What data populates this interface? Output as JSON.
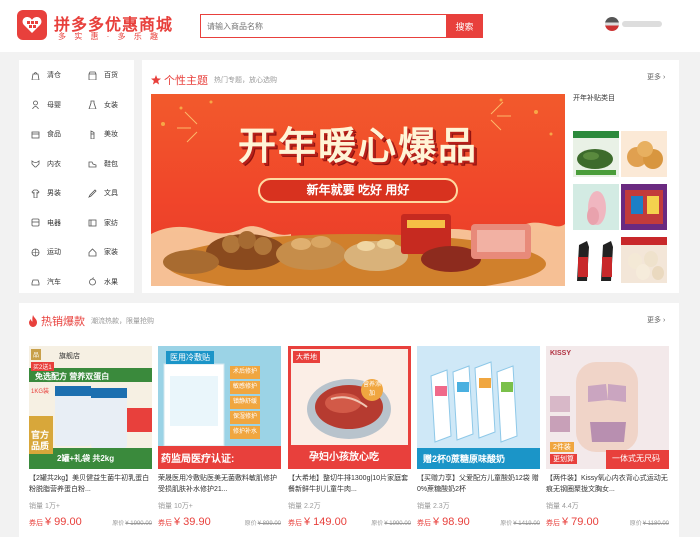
{
  "colors": {
    "brand": "#e8403c"
  },
  "header": {
    "logo_icon": "heart-grid-icon",
    "title": "拼多多优惠商城",
    "slogan": "多 实 惠 · 多 乐 趣",
    "search": {
      "placeholder": "请输入商品名称",
      "button": "搜索"
    }
  },
  "categories": [
    {
      "label": "清仓",
      "icon": "bag-icon"
    },
    {
      "label": "百货",
      "icon": "store-icon"
    },
    {
      "label": "母婴",
      "icon": "baby-icon"
    },
    {
      "label": "女装",
      "icon": "dress-icon"
    },
    {
      "label": "食品",
      "icon": "food-icon"
    },
    {
      "label": "美妆",
      "icon": "lipstick-icon"
    },
    {
      "label": "内衣",
      "icon": "underwear-icon"
    },
    {
      "label": "鞋包",
      "icon": "shoe-icon"
    },
    {
      "label": "男装",
      "icon": "shirt-icon"
    },
    {
      "label": "文具",
      "icon": "pen-icon"
    },
    {
      "label": "电器",
      "icon": "appliance-icon"
    },
    {
      "label": "家纺",
      "icon": "bedding-icon"
    },
    {
      "label": "运动",
      "icon": "ball-icon"
    },
    {
      "label": "家装",
      "icon": "home-icon"
    },
    {
      "label": "汽车",
      "icon": "car-icon"
    },
    {
      "label": "水果",
      "icon": "fruit-icon"
    }
  ],
  "theme": {
    "icon": "star-icon",
    "title": "个性主题",
    "subtitle": "热门专题，放心选购",
    "more": "更多",
    "banner_title": "开年暖心爆品",
    "banner_subtitle": "新年就要 吃好 用好",
    "side_title": "开年补贴类目"
  },
  "hot": {
    "icon": "fire-icon",
    "title": "热销爆款",
    "subtitle": "潮流热款，限量抢购",
    "more": "更多",
    "products": [
      {
        "title": "【2罐共2kg】美贝健益生菌牛初乳蛋白粉脱脂营养蛋白粉...",
        "sales": "销量 1万+",
        "price_label": "券后",
        "price": "¥ 99.00",
        "orig_label": "原价",
        "orig_price": "¥ 1990.00",
        "img_top": "旗舰店",
        "img_badge1": "买2送1",
        "img_badge2": "1KG装",
        "img_ribbon": "免选配方 营养双蛋白",
        "img_tag": "官方",
        "img_tag2": "品质",
        "img_bottom": "2罐+礼袋 共2kg"
      },
      {
        "title": "荣晟医用冷敷贴医美无菌敷料敏肌修护受损肌肤补水修护21...",
        "sales": "销量 10万+",
        "price_label": "券后",
        "price": "¥ 39.90",
        "orig_label": "原价",
        "orig_price": "¥ 899.00",
        "img_top": "医用冷敷贴",
        "img_checks": [
          "术后修护",
          "敏感修护",
          "镇静舒缓",
          "保湿修护",
          "修护补水"
        ],
        "img_bottom": "药监局医疗认证:"
      },
      {
        "title": "【大希地】整切牛排1300g|10片家庭套餐新鲜牛扒儿童牛肉...",
        "sales": "销量 2.2万",
        "price_label": "券后",
        "price": "¥ 149.00",
        "orig_label": "原价",
        "orig_price": "¥ 1990.00",
        "img_top": "大希地",
        "img_badge1": "营养添加",
        "img_bottom": "孕妇小孩放心吃"
      },
      {
        "title": "【买赠力享】父爱配方儿童酸奶12袋 赠0%蔗糖酸奶2杯",
        "sales": "销量 2.3万",
        "price_label": "券后",
        "price": "¥ 98.90",
        "orig_label": "原价",
        "orig_price": "¥ 1419.00",
        "img_bottom": "赠2杯0蔗糖原味酸奶"
      },
      {
        "title": "【两件装】Kissy氧心内衣背心式运动无痕无钢圈聚拢文胸女...",
        "sales": "销量 4.4万",
        "price_label": "券后",
        "price": "¥ 79.00",
        "orig_label": "原价",
        "orig_price": "¥ 1180.00",
        "img_top": "KISSY",
        "img_badge1": "2件装",
        "img_badge2": "更划算",
        "img_bottom": "一体式无尺码"
      }
    ]
  }
}
